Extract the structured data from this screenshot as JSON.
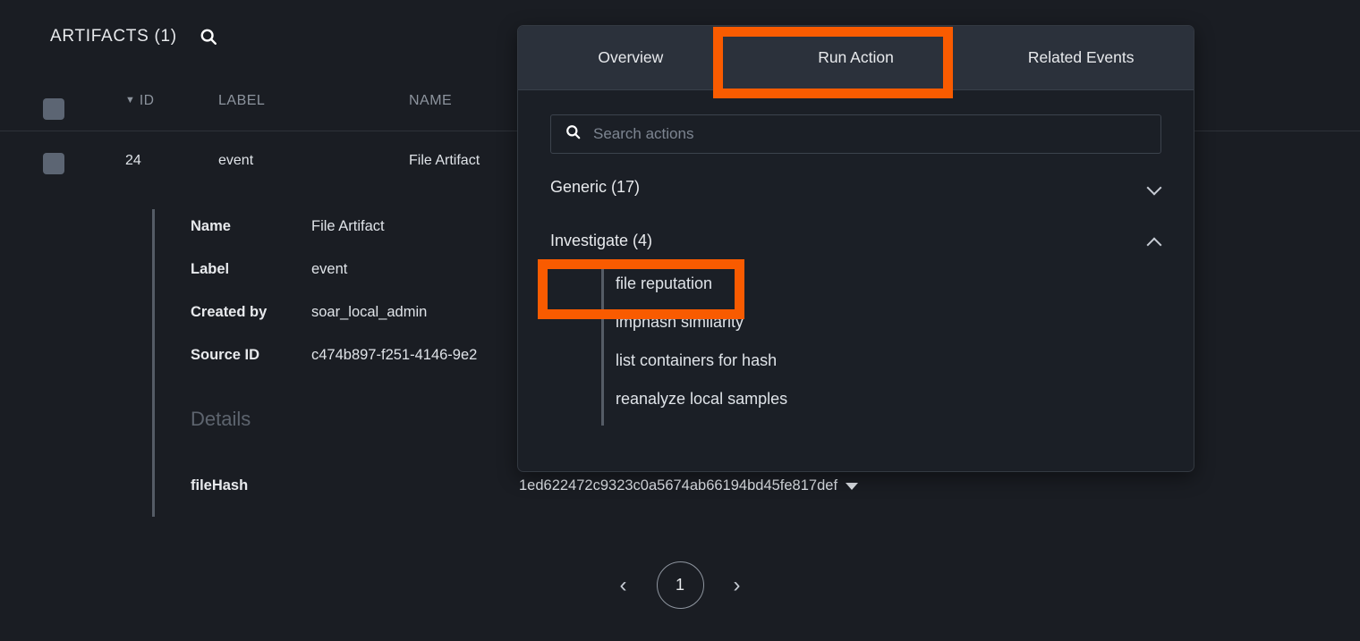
{
  "colors": {
    "background": "#1a1d23",
    "panel_background": "#1b1f26",
    "tab_bar": "#2b313b",
    "annotation_orange": "#f95b00",
    "muted_text": "#8d949e",
    "accent_line": "#555c66"
  },
  "artifacts": {
    "title": "ARTIFACTS (1)",
    "search_icon": "search-icon",
    "columns": [
      "ID",
      "LABEL",
      "NAME"
    ],
    "sort_indicator": "▼",
    "rows": [
      {
        "id": "24",
        "label": "event",
        "name": "File Artifact"
      }
    ],
    "detail": {
      "fields": [
        {
          "key": "Name",
          "value": "File Artifact"
        },
        {
          "key": "Label",
          "value": "event"
        },
        {
          "key": "Created by",
          "value": "soar_local_admin"
        },
        {
          "key": "Source ID",
          "value": "c474b897-f251-4146-9e2"
        }
      ],
      "subheading": "Details",
      "filehash_key": "fileHash",
      "filehash_value": "1ed622472c9323c0a5674ab66194bd45fe817def",
      "filehash_caret": "caret-down-icon"
    },
    "pagination": {
      "prev_label": "‹",
      "next_label": "›",
      "current_page": "1"
    }
  },
  "action_panel": {
    "tabs": [
      {
        "label": "Overview",
        "active": false
      },
      {
        "label": "Run Action",
        "active": true
      },
      {
        "label": "Related Events",
        "active": false
      }
    ],
    "search": {
      "placeholder": "Search actions",
      "value": "",
      "icon": "search-icon"
    },
    "groups": [
      {
        "title": "Generic (17)",
        "expanded": false,
        "chevron": "chevron-down-icon",
        "items": []
      },
      {
        "title": "Investigate (4)",
        "expanded": true,
        "chevron": "chevron-up-icon",
        "items": [
          "file reputation",
          "imphash similarity",
          "list containers for hash",
          "reanalyze local samples"
        ]
      }
    ]
  },
  "annotations": [
    {
      "target": "Run Action",
      "shape": "rectangle",
      "color": "#f95b00"
    },
    {
      "target": "file reputation",
      "shape": "rectangle",
      "color": "#f95b00"
    }
  ]
}
